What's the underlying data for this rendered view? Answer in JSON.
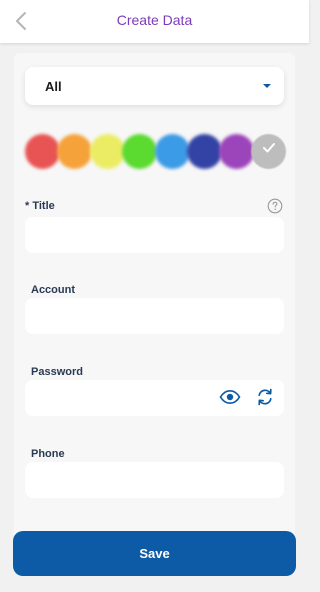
{
  "header": {
    "title": "Create Data",
    "back_icon": "chevron-left-icon"
  },
  "category": {
    "selected": "All",
    "arrow_icon": "caret-down-icon"
  },
  "colors": {
    "swatches": [
      "#e85454",
      "#f6a23a",
      "#ecec64",
      "#5bda30",
      "#3c9be6",
      "#3343a5",
      "#9c44ba",
      "#bdbdbd"
    ],
    "selected_index": 7,
    "check_icon": "check-icon"
  },
  "form": {
    "title": {
      "label": "* Title",
      "value": "",
      "help_icon": "help-circle-icon"
    },
    "account": {
      "label": "Account",
      "value": ""
    },
    "password": {
      "label": "Password",
      "value": "",
      "show_icon": "eye-icon",
      "generate_icon": "refresh-icon"
    },
    "phone": {
      "label": "Phone",
      "value": ""
    }
  },
  "actions": {
    "save_label": "Save"
  },
  "theme": {
    "accent": "#0d5aa6",
    "header_title": "#7b3bb8",
    "label": "#2b3a52"
  }
}
